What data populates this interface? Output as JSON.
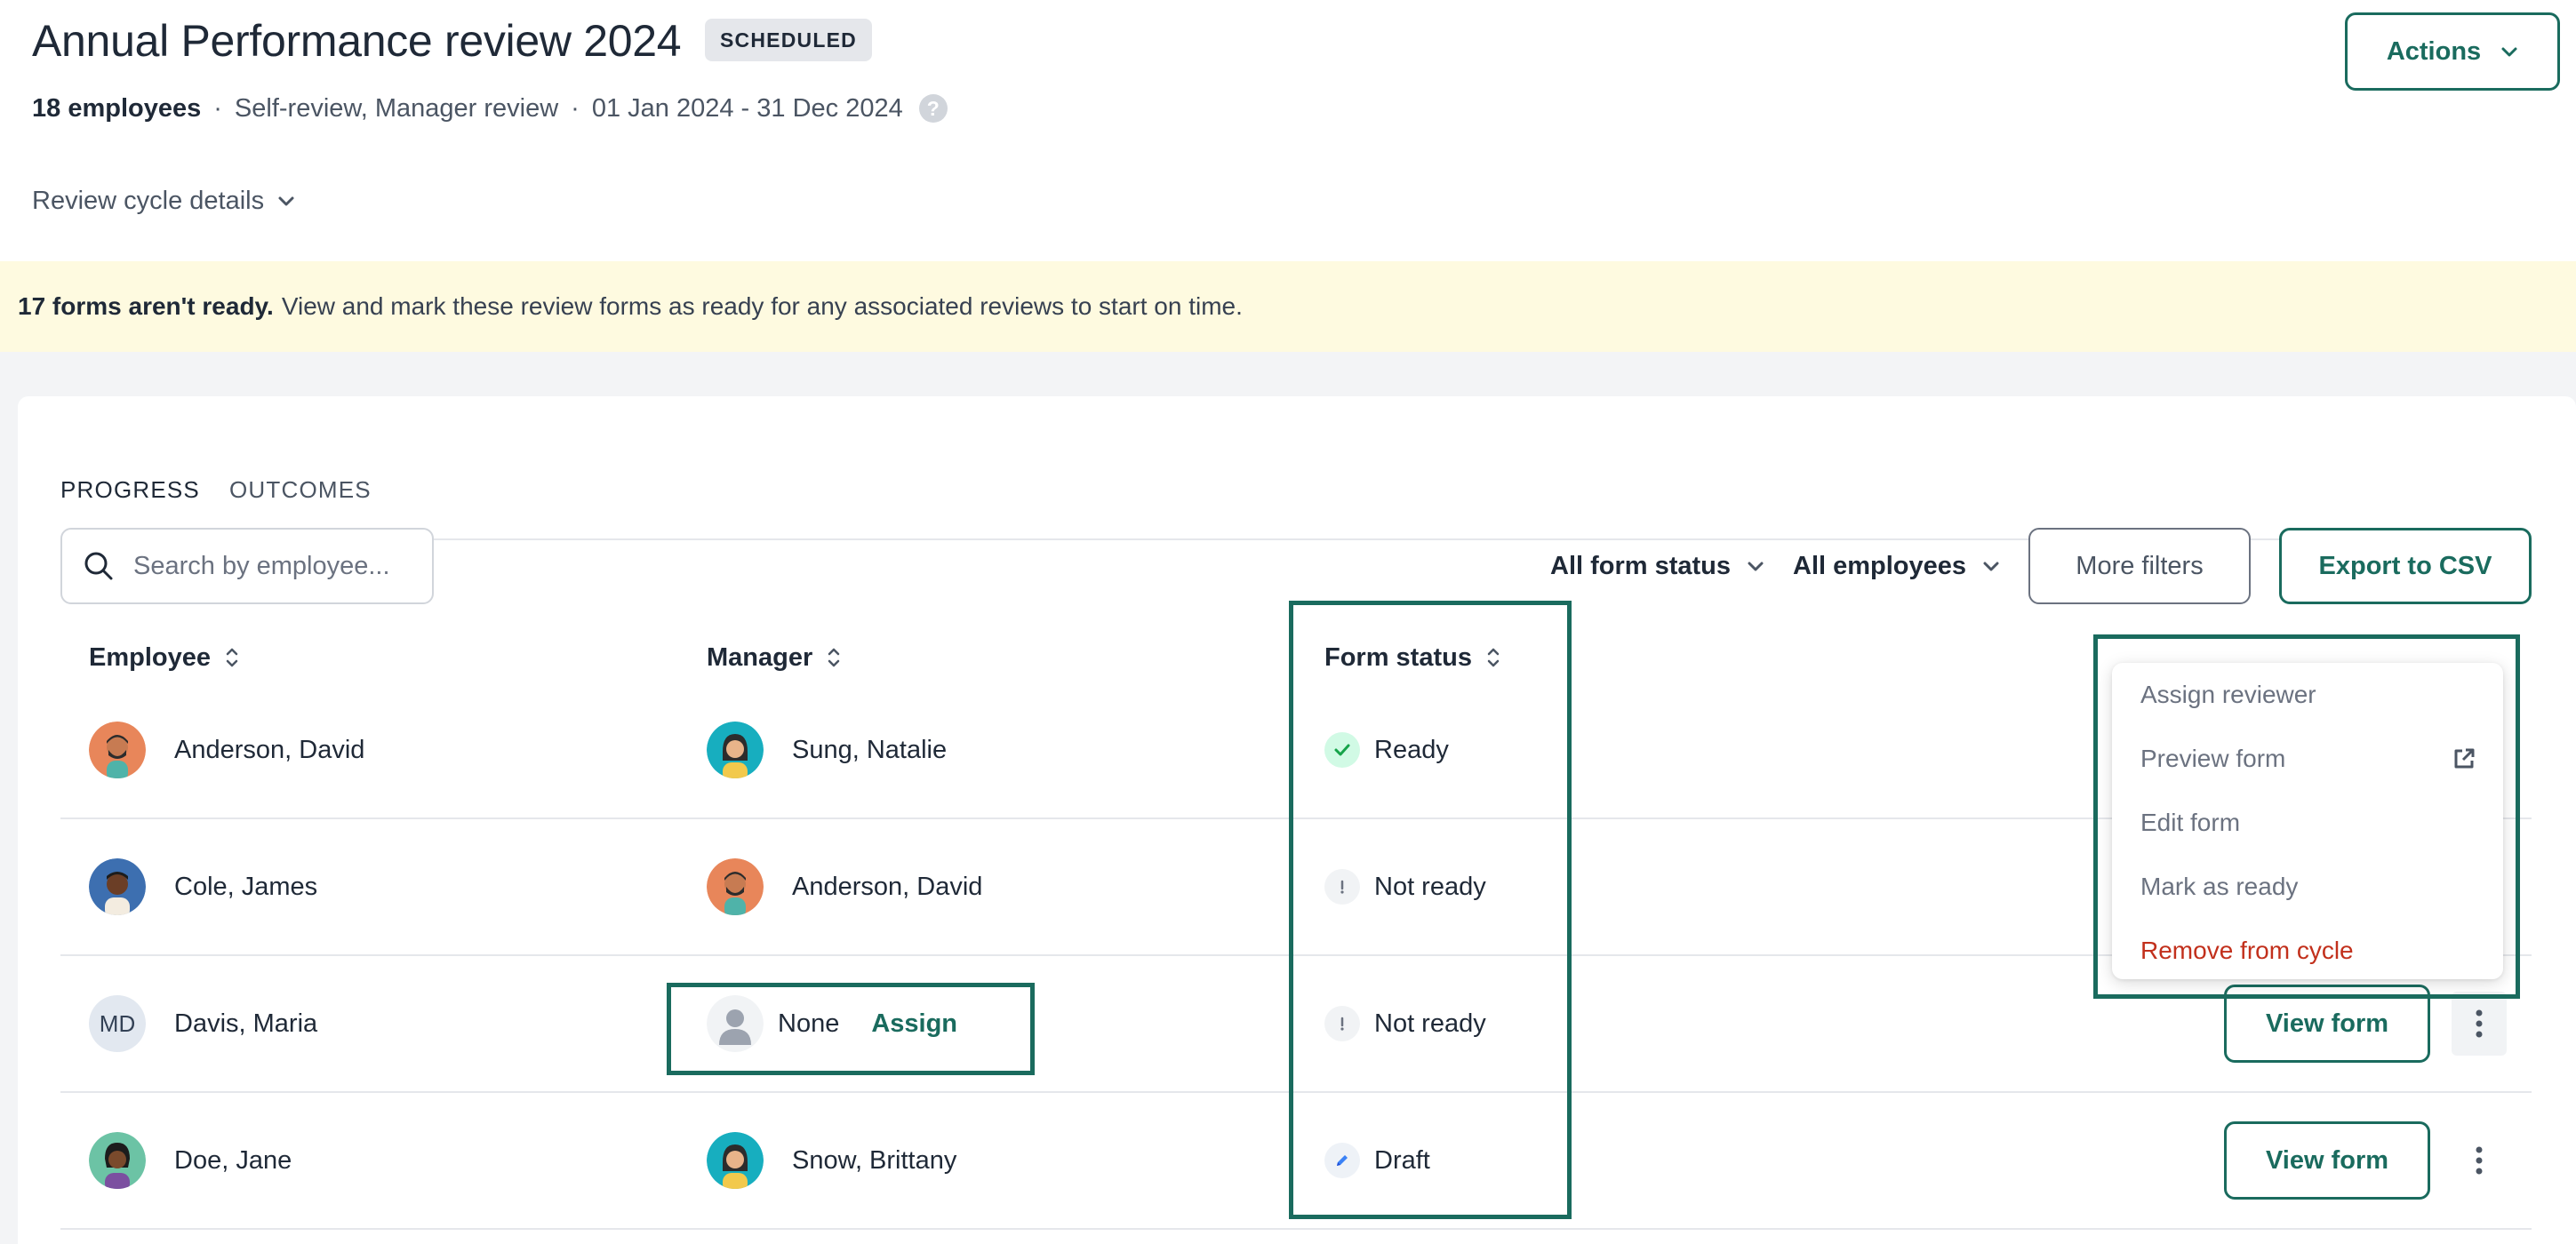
{
  "header": {
    "title": "Annual Performance review 2024",
    "badge": "SCHEDULED",
    "employees": "18 employees",
    "review_types": "Self-review, Manager review",
    "date_range": "01 Jan 2024 - 31 Dec 2024",
    "help_glyph": "?",
    "separator": "·",
    "actions_label": "Actions",
    "cycle_details_label": "Review cycle details"
  },
  "banner": {
    "bold": "17 forms aren't ready.",
    "text": "View and mark these review forms as ready for any associated reviews to start on time."
  },
  "tabs": [
    {
      "label": "PROGRESS",
      "active": true
    },
    {
      "label": "OUTCOMES",
      "active": false
    }
  ],
  "toolbar": {
    "search_placeholder": "Search by employee...",
    "form_status_filter": "All form status",
    "employees_filter": "All employees",
    "more_filters": "More filters",
    "export": "Export to CSV"
  },
  "table": {
    "columns": [
      "Employee",
      "Manager",
      "Form status"
    ],
    "rows": [
      {
        "employee": "Anderson, David",
        "employee_avatar": "avatar-orange-man",
        "manager": "Sung, Natalie",
        "manager_avatar": "avatar-teal-woman",
        "status": "Ready",
        "status_icon": "check-icon",
        "action": ""
      },
      {
        "employee": "Cole, James",
        "employee_avatar": "avatar-blue-man",
        "manager": "Anderson, David",
        "manager_avatar": "avatar-orange-man",
        "status": "Not ready",
        "status_icon": "exclamation-icon",
        "action": ""
      },
      {
        "employee": "Davis, Maria",
        "employee_initials": "MD",
        "manager": "None",
        "manager_avatar": "placeholder-avatar",
        "manager_action": "Assign",
        "status": "Not ready",
        "status_icon": "exclamation-icon",
        "action": "View form"
      },
      {
        "employee": "Doe, Jane",
        "employee_avatar": "avatar-green-woman",
        "manager": "Snow, Brittany",
        "manager_avatar": "avatar-teal-woman",
        "status": "Draft",
        "status_icon": "pencil-icon",
        "action": "View form"
      }
    ]
  },
  "context_menu": {
    "items": [
      {
        "label": "Assign reviewer"
      },
      {
        "label": "Preview form",
        "icon": "external-link-icon"
      },
      {
        "label": "Edit form"
      },
      {
        "label": "Mark as ready"
      },
      {
        "label": "Remove from cycle",
        "danger": true
      }
    ]
  },
  "colors": {
    "accent": "#1a6b5e",
    "banner_bg": "#fefae0",
    "danger": "#c2301c",
    "ready": "#16a34a"
  }
}
